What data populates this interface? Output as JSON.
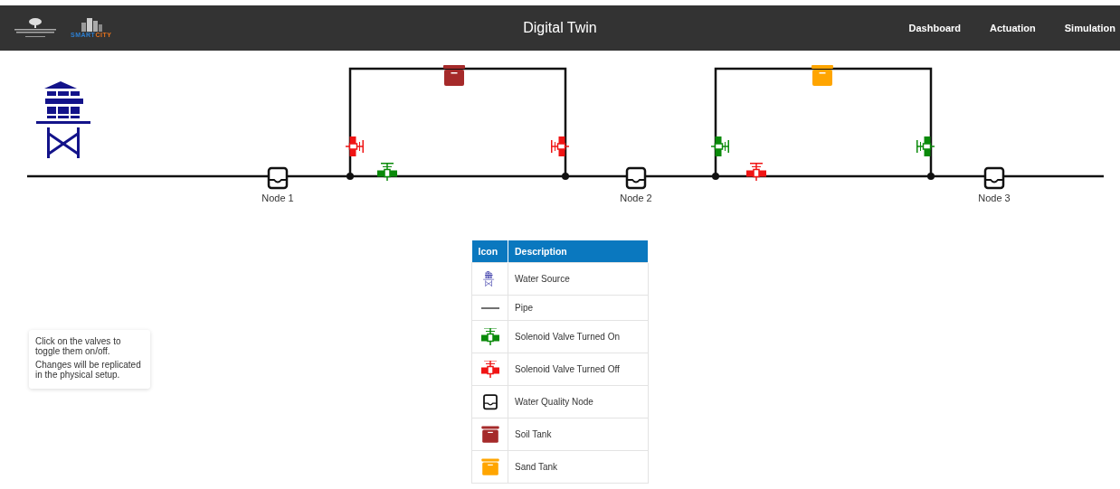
{
  "header": {
    "brand": {
      "smart": "SMART",
      "city": "CITY"
    },
    "title": "Digital Twin",
    "nav": [
      {
        "label": "Dashboard"
      },
      {
        "label": "Actuation"
      },
      {
        "label": "Simulation"
      }
    ]
  },
  "diagram": {
    "nodes": [
      {
        "label": "Node 1"
      },
      {
        "label": "Node 2"
      },
      {
        "label": "Node 3"
      }
    ],
    "tanks": [
      {
        "color": "#a52a2a"
      },
      {
        "color": "#ffa500"
      }
    ],
    "valves": [
      {
        "kind": "vertical",
        "on": false
      },
      {
        "kind": "mirrored",
        "on": false
      },
      {
        "kind": "horizontal",
        "on": true
      },
      {
        "kind": "vertical",
        "on": true
      },
      {
        "kind": "mirrored",
        "on": true
      },
      {
        "kind": "horizontal",
        "on": false
      }
    ]
  },
  "info": [
    "Click on the valves to toggle them on/off.",
    "Changes will be replicated in the physical setup."
  ],
  "legend": {
    "columns": [
      "Icon",
      "Description"
    ],
    "rows": [
      {
        "kind": "tower",
        "description": "Water Source"
      },
      {
        "kind": "line",
        "description": "Pipe"
      },
      {
        "kind": "green",
        "description": "Solenoid Valve Turned On"
      },
      {
        "kind": "red",
        "description": "Solenoid Valve Turned Off"
      },
      {
        "kind": "node",
        "description": "Water Quality Node"
      },
      {
        "kind": "brown",
        "description": "Soil Tank"
      },
      {
        "kind": "orange",
        "description": "Sand Tank"
      }
    ]
  }
}
